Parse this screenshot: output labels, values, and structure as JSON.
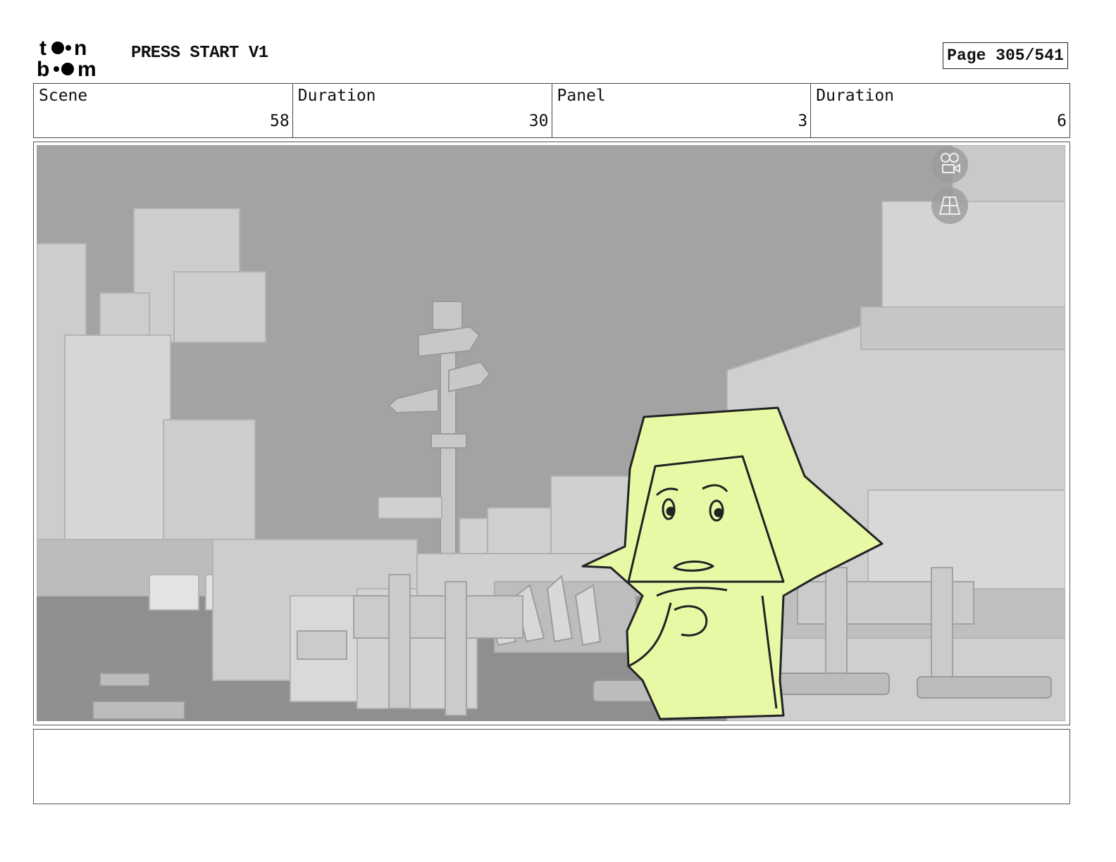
{
  "header": {
    "logo_text_top": "toon",
    "logo_text_bottom": "boom",
    "project_title": "PRESS START V1",
    "page_label": "Page 305/541"
  },
  "info": {
    "scene_label": "Scene",
    "scene_value": "58",
    "scene_duration_label": "Duration",
    "scene_duration_value": "30",
    "panel_label": "Panel",
    "panel_value": "3",
    "panel_duration_label": "Duration",
    "panel_duration_value": "6"
  },
  "panel": {
    "viewer_icons": [
      "camera-icon",
      "grid-floor-icon"
    ]
  },
  "notes": {
    "text": ""
  },
  "colors": {
    "sky": "#a3a3a3",
    "blocks": "#cfcfcf",
    "character_fill": "#e8f9a6",
    "line": "#222222"
  }
}
